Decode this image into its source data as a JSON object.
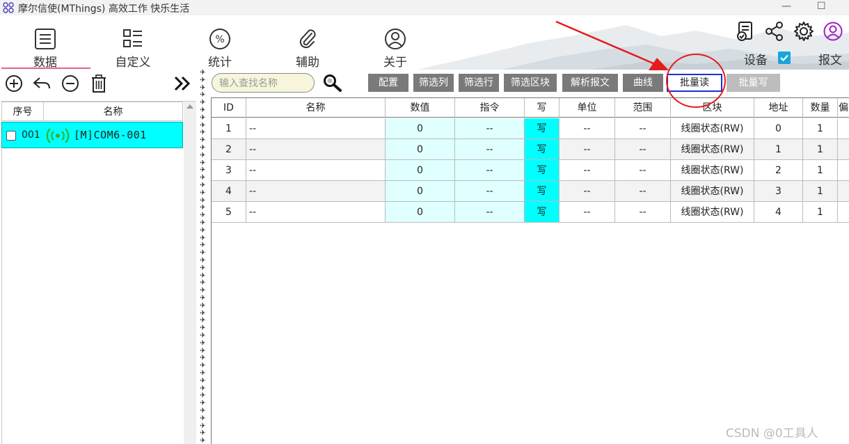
{
  "window": {
    "title": "摩尔信使(MThings) 高效工作 快乐生活",
    "minimize": "—",
    "maximize": "☐"
  },
  "nav": [
    {
      "label": "数据",
      "icon": "list-box-icon",
      "active": true
    },
    {
      "label": "自定义",
      "icon": "grid-list-icon",
      "active": false
    },
    {
      "label": "统计",
      "icon": "percent-icon",
      "active": false
    },
    {
      "label": "辅助",
      "icon": "paperclip-icon",
      "active": false
    },
    {
      "label": "关于",
      "icon": "user-circle-icon",
      "active": false
    }
  ],
  "top_right": {
    "device_label": "设备",
    "device_checked": true,
    "message_label": "报文"
  },
  "left": {
    "col_index": "序号",
    "col_name": "名称",
    "devices": [
      {
        "index": "001",
        "name": "[M]COM6-001",
        "checked": false,
        "selected": true
      }
    ]
  },
  "toolbar": {
    "search_placeholder": "输入查找名称",
    "buttons": [
      {
        "label": "配置",
        "style": "dark"
      },
      {
        "label": "筛选列",
        "style": "dark"
      },
      {
        "label": "筛选行",
        "style": "dark"
      },
      {
        "label": "筛选区块",
        "style": "dark"
      },
      {
        "label": "解析报文",
        "style": "dark"
      },
      {
        "label": "曲线",
        "style": "dark"
      },
      {
        "label": "批量读",
        "style": "selected"
      },
      {
        "label": "批量写",
        "style": "light"
      }
    ]
  },
  "table": {
    "columns": [
      "ID",
      "名称",
      "数值",
      "指令",
      "写",
      "单位",
      "范围",
      "区块",
      "地址",
      "数量",
      "偏"
    ],
    "rows": [
      [
        "1",
        "--",
        "0",
        "--",
        "写",
        "--",
        "--",
        "线圈状态(RW)",
        "0",
        "1",
        ""
      ],
      [
        "2",
        "--",
        "0",
        "--",
        "写",
        "--",
        "--",
        "线圈状态(RW)",
        "1",
        "1",
        ""
      ],
      [
        "3",
        "--",
        "0",
        "--",
        "写",
        "--",
        "--",
        "线圈状态(RW)",
        "2",
        "1",
        ""
      ],
      [
        "4",
        "--",
        "0",
        "--",
        "写",
        "--",
        "--",
        "线圈状态(RW)",
        "3",
        "1",
        ""
      ],
      [
        "5",
        "--",
        "0",
        "--",
        "写",
        "--",
        "--",
        "线圈状态(RW)",
        "4",
        "1",
        ""
      ]
    ]
  },
  "watermark": "CSDN @0工具人",
  "colors": {
    "accent_cyan": "#00ffff",
    "value_cell": "#e0ffff",
    "nav_underline": "#e8608a",
    "annotation_red": "#e61b1b",
    "selected_border": "#1a2fd6"
  }
}
